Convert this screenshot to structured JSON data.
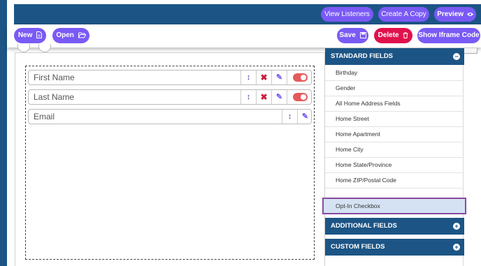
{
  "header": {
    "buttons": {
      "view_listeners": "View Listeners",
      "create_copy": "Create A Copy",
      "preview": "Preview"
    }
  },
  "toolbar": {
    "new_label": "New",
    "open_label": "Open",
    "save_label": "Save",
    "delete_label": "Delete",
    "iframe_label": "Show Iframe Code"
  },
  "form": {
    "fields": [
      {
        "label": "First Name",
        "toggle": "on"
      },
      {
        "label": "Last Name",
        "toggle": "on"
      },
      {
        "label": "Email"
      }
    ]
  },
  "panel": {
    "standard_title": "STANDARD FIELDS",
    "standard_items": [
      "Birthday",
      "Gender",
      "All Home Address Fields",
      "Home Street",
      "Home Apartment",
      "Home City",
      "Home State/Province",
      "Home ZIP/Postal Code",
      "Opt-In Checkbox"
    ],
    "additional_title": "ADDITIONAL FIELDS",
    "custom_title": "CUSTOM FIELDS"
  },
  "colors": {
    "brand_blue": "#1c5585",
    "accent_purple": "#7a5af5",
    "danger_red": "#e0114c",
    "highlight_border": "#8a4aa0"
  }
}
